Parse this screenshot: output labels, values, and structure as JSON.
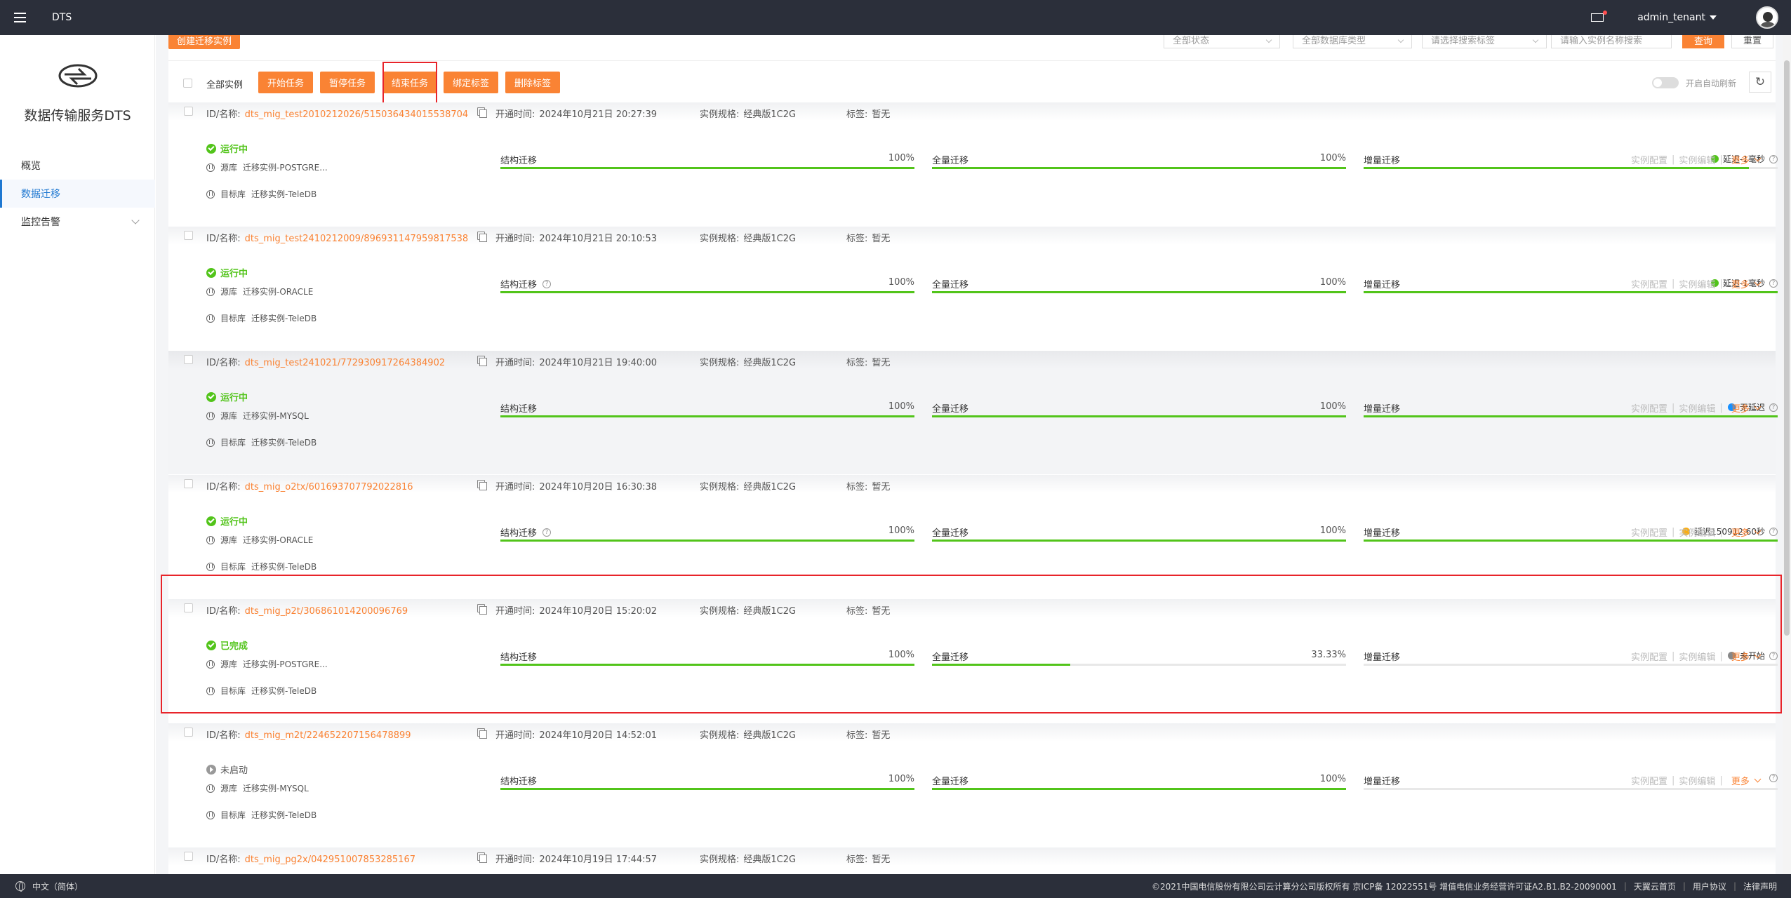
{
  "topbar": {
    "app_name": "DTS",
    "tenant": "admin_tenant"
  },
  "sidebar": {
    "title": "数据传输服务DTS",
    "items": [
      {
        "label": "概览"
      },
      {
        "label": "数据迁移"
      },
      {
        "label": "监控告警"
      }
    ]
  },
  "filters": {
    "create_label": "创建迁移实例",
    "status_select": "全部状态",
    "dbtype_select": "全部数据库类型",
    "tag_select": "请选择搜索标签",
    "search_placeholder": "请输入实例名称搜索",
    "query_label": "查询",
    "reset_label": "重置"
  },
  "toolbar": {
    "select_all": "全部实例",
    "buttons": [
      "开始任务",
      "暂停任务",
      "结束任务",
      "绑定标签",
      "删除标签"
    ],
    "auto_refresh": "开启自动刷新",
    "refresh_icon": "↻"
  },
  "labels": {
    "id_prefix": "ID/名称:",
    "opened_prefix": "开通时间:",
    "spec_prefix": "实例规格:",
    "tag_prefix": "标签:",
    "src_prefix": "源库",
    "dst_prefix": "目标库",
    "stage_struct": "结构迁移",
    "stage_full": "全量迁移",
    "stage_incr": "增量迁移",
    "action_config": "实例配置",
    "action_edit": "实例编辑",
    "action_more": "更多",
    "help_glyph": "?"
  },
  "tasks": [
    {
      "id_name": "dts_mig_test2010212026/515036434015538704",
      "opened": "2024年10月21日 20:27:39",
      "spec": "经典版1C2G",
      "tag": "暂无",
      "status": "运行中",
      "source": "迁移实例-POSTGRE...",
      "target": "迁移实例-TeleDB",
      "struct_pct": 100,
      "struct_text": "100%",
      "full_pct": 100,
      "full_text": "100%",
      "incr_pct": 93,
      "delay": "延迟-1毫秒",
      "delay_color": "#52c41a"
    },
    {
      "id_name": "dts_mig_test2410212009/896931147959817538",
      "opened": "2024年10月21日 20:10:53",
      "spec": "经典版1C2G",
      "tag": "暂无",
      "status": "运行中",
      "source": "迁移实例-ORACLE",
      "target": "迁移实例-TeleDB",
      "struct_pct": 100,
      "struct_text": "100%",
      "full_pct": 100,
      "full_text": "100%",
      "incr_pct": 100,
      "delay": "延迟-1毫秒",
      "delay_color": "#52c41a"
    },
    {
      "id_name": "dts_mig_test241021/772930917264384902",
      "opened": "2024年10月21日 19:40:00",
      "spec": "经典版1C2G",
      "tag": "暂无",
      "status": "运行中",
      "source": "迁移实例-MYSQL",
      "target": "迁移实例-TeleDB",
      "struct_pct": 100,
      "struct_text": "100%",
      "full_pct": 100,
      "full_text": "100%",
      "incr_pct": 100,
      "delay": "无延迟",
      "delay_color": "#1890ff"
    },
    {
      "id_name": "dts_mig_o2tx/601693707792022816",
      "opened": "2024年10月20日 16:30:38",
      "spec": "经典版1C2G",
      "tag": "暂无",
      "status": "运行中",
      "source": "迁移实例-ORACLE",
      "target": "迁移实例-TeleDB",
      "struct_pct": 100,
      "struct_text": "100%",
      "full_pct": 100,
      "full_text": "100%",
      "incr_pct": 100,
      "delay": "延迟150912.60秒",
      "delay_color": "#faad14"
    },
    {
      "id_name": "dts_mig_p2t/306861014200096769",
      "opened": "2024年10月20日 15:20:02",
      "spec": "经典版1C2G",
      "tag": "暂无",
      "status": "已完成",
      "source": "迁移实例-POSTGRE...",
      "target": "迁移实例-TeleDB",
      "struct_pct": 100,
      "struct_text": "100%",
      "full_pct": 33.33,
      "full_text": "33.33%",
      "incr_pct": 0,
      "delay": "未开始",
      "delay_color": "#888888"
    },
    {
      "id_name": "dts_mig_m2t/224652207156478899",
      "opened": "2024年10月20日 14:52:01",
      "spec": "经典版1C2G",
      "tag": "暂无",
      "status": "未启动",
      "source": "迁移实例-MYSQL",
      "target": "迁移实例-TeleDB",
      "struct_pct": 100,
      "struct_text": "100%",
      "full_pct": 100,
      "full_text": "100%",
      "incr_pct": 0,
      "delay": "",
      "delay_color": ""
    },
    {
      "id_name": "dts_mig_pg2x/042951007853285167",
      "opened": "2024年10月19日 17:44:57",
      "spec": "经典版1C2G",
      "tag": "暂无"
    }
  ],
  "footer": {
    "language": "中文（简体）",
    "copyright": "©2021中国电信股份有限公司云计算分公司版权所有 京ICP备 12022551号 增值电信业务经营许可证A2.B1.B2-20090001",
    "links": [
      "天翼云首页",
      "用户协议",
      "法律声明"
    ]
  },
  "colors": {
    "accent": "#fa8334",
    "success": "#52c41a",
    "highlight_box": "#e8242a",
    "topbar": "#2b2f3a",
    "link_blue": "#1f78d1"
  }
}
